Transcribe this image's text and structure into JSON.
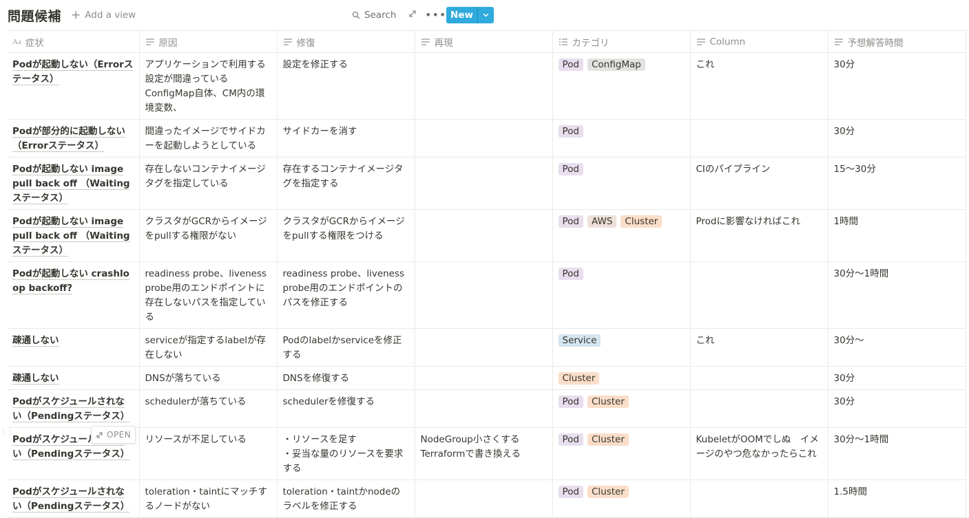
{
  "header": {
    "title": "問題候補",
    "add_view": "Add a view",
    "search": "Search",
    "new_label": "New"
  },
  "columns": [
    {
      "label": "症状",
      "icon": "title-icon"
    },
    {
      "label": "原因",
      "icon": "text-icon"
    },
    {
      "label": "修復",
      "icon": "text-icon"
    },
    {
      "label": "再現",
      "icon": "text-icon"
    },
    {
      "label": "カテゴリ",
      "icon": "multiselect-icon"
    },
    {
      "label": "Column",
      "icon": "text-icon"
    },
    {
      "label": "予想解答時間",
      "icon": "text-icon"
    }
  ],
  "rows": [
    {
      "name": "Podが起動しない（Errorステータス）",
      "cause": "アプリケーションで利用する設定が間違っている\nConfigMap自体、CM内の環境変数、",
      "fix": "設定を修正する",
      "repro": "",
      "tags": [
        {
          "label": "Pod",
          "color": "purple"
        },
        {
          "label": "ConfigMap",
          "color": "gray"
        }
      ],
      "column": "これ",
      "time": "30分"
    },
    {
      "name": "Podが部分的に起動しない（Errorステータス）",
      "cause": "間違ったイメージでサイドカーを起動しようとしている",
      "fix": "サイドカーを消す",
      "repro": "",
      "tags": [
        {
          "label": "Pod",
          "color": "purple"
        }
      ],
      "column": "",
      "time": "30分"
    },
    {
      "name": "Podが起動しない image pull back off （Waitingステータス）",
      "cause": "存在しないコンテナイメージタグを指定している",
      "fix": "存在するコンテナイメージタグを指定する",
      "repro": "",
      "tags": [
        {
          "label": "Pod",
          "color": "purple"
        }
      ],
      "column": "CIのパイプライン",
      "time": "15〜30分"
    },
    {
      "name": "Podが起動しない image pull back off （Waitingステータス）",
      "cause": "クラスタがGCRからイメージをpullする権限がない",
      "fix": "クラスタがGCRからイメージをpullする権限をつける",
      "repro": "",
      "tags": [
        {
          "label": "Pod",
          "color": "purple"
        },
        {
          "label": "AWS",
          "color": "brown"
        },
        {
          "label": "Cluster",
          "color": "orange"
        }
      ],
      "column": "Prodに影響なければこれ",
      "time": "1時間"
    },
    {
      "name": "Podが起動しない crashloop backoff?",
      "cause": "readiness probe、liveness probe用のエンドポイントに存在しないパスを指定している",
      "fix": "readiness probe、liveness probe用のエンドポイントのパスを修正する",
      "repro": "",
      "tags": [
        {
          "label": "Pod",
          "color": "purple"
        }
      ],
      "column": "",
      "time": "30分〜1時間"
    },
    {
      "name": "疎通しない",
      "cause": "serviceが指定するlabelが存在しない",
      "fix": "Podのlabelかserviceを修正する",
      "repro": "",
      "tags": [
        {
          "label": "Service",
          "color": "blue"
        }
      ],
      "column": "これ",
      "time": "30分〜"
    },
    {
      "name": "疎通しない",
      "cause": "DNSが落ちている",
      "fix": "DNSを修復する",
      "repro": "",
      "tags": [
        {
          "label": "Cluster",
          "color": "orange"
        }
      ],
      "column": "",
      "time": "30分"
    },
    {
      "name": "Podがスケジュールされない（Pendingステータス）",
      "cause": "schedulerが落ちている",
      "fix": "schedulerを修復する",
      "repro": "",
      "tags": [
        {
          "label": "Pod",
          "color": "purple"
        },
        {
          "label": "Cluster",
          "color": "orange"
        }
      ],
      "column": "",
      "time": "30分"
    },
    {
      "name": "Podがスケジュールされない（Pendingステータス）",
      "cause": "リソースが不足している",
      "fix": "・リソースを足す\n・妥当な量のリソースを要求する",
      "repro": "NodeGroup小さくする\nTerraformで書き換える",
      "tags": [
        {
          "label": "Pod",
          "color": "purple"
        },
        {
          "label": "Cluster",
          "color": "orange"
        }
      ],
      "column": "KubeletがOOMでしぬ　イメージのやつ危なかったらこれ",
      "time": "30分〜1時間"
    },
    {
      "name": "Podがスケジュールされない（Pendingステータス）",
      "cause": "toleration・taintにマッチするノードがない",
      "fix": "toleration・taintかnodeのラベルを修正する",
      "repro": "",
      "tags": [
        {
          "label": "Pod",
          "color": "purple"
        },
        {
          "label": "Cluster",
          "color": "orange"
        }
      ],
      "column": "",
      "time": "1.5時間"
    }
  ],
  "open_chip": "OPEN"
}
